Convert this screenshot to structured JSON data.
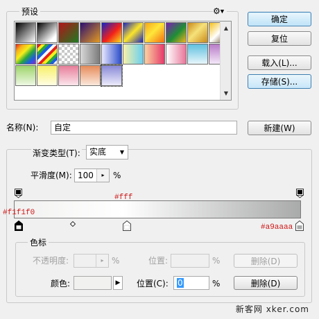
{
  "presets": {
    "title": "预设",
    "swatches": [
      [
        "linear-gradient(135deg,#000 0%,#fff 100%)"
      ],
      [
        "linear-gradient(135deg,#000 0%,#fff 80%)"
      ],
      [
        "linear-gradient(135deg,#b3141a 0%,#1f7a21 100%)"
      ],
      [
        "linear-gradient(135deg,#2a0f72 0%,#e59a20 100%)"
      ],
      [
        "linear-gradient(135deg,#1326c4 0%,#f2201a 55%,#f8e21a 100%)"
      ],
      [
        "linear-gradient(135deg,#1d26bb 0%,#fbe52a 50%,#1d26bb 100%)"
      ],
      [
        "linear-gradient(135deg,#f4a718 0%,#ffe63a 45%,#f26d12 100%)"
      ],
      [
        "linear-gradient(135deg,#7b1fb4 0%,#1e8e35 55%,#f2b21d 100%)"
      ],
      [
        "linear-gradient(135deg,#c98a1a 0%,#f6e27a 45%,#c98a1a 100%)"
      ],
      [
        "linear-gradient(135deg,#f5c01a 0%,#fff 50%,#5a3a10 100%)"
      ],
      [
        "linear-gradient(135deg,#e8211a,#f5b01a,#f7ee1a,#2aa83a,#1a5fe0,#8a2ad8)"
      ],
      [
        "repeating-linear-gradient(135deg,#e8211a 0 4px,#f7ee1a 4px 8px,#2aa83a 8px 12px,#1a5fe0 12px 16px,#fff 16px 20px)"
      ],
      [
        "repeating-conic-gradient(#c8c8c8 0 25%,#ffffff 0 50%) 0 0/8px 8px"
      ],
      [
        "linear-gradient(to right,#d8d8d8 0%,#7a7a7a 100%)"
      ],
      [
        "linear-gradient(to right,#e8e8ff 0%,#2a4cc9 100%)"
      ],
      [
        "linear-gradient(to right,#f8f0a8 0%,#6ad0f0 100%)"
      ],
      [
        "linear-gradient(to right,#fbd3a0 0%,#e6386a 100%)"
      ],
      [
        "linear-gradient(to right,#ffffff 0%,#e8769a 100%)"
      ],
      [
        "linear-gradient(to bottom,#5fc0e0 0%,#e8f6fb 100%)"
      ],
      [
        "linear-gradient(to bottom,#b87cc8 0%,#f4e8f8 100%)"
      ],
      [
        "linear-gradient(to bottom,#9ed46a 0%,#eef8e4 100%)"
      ],
      [
        "linear-gradient(to bottom,#f7f06a 0%,#fffde4 100%)"
      ],
      [
        "linear-gradient(to bottom,#e87e9a 0%,#fbe6ec 100%)"
      ],
      [
        "linear-gradient(to bottom,#e68c5a 0%,#fbe8dc 100%)"
      ],
      [
        "linear-gradient(to bottom,#8a8ad8 0%,#ecebfb 100%)"
      ]
    ]
  },
  "buttons": {
    "ok": "确定",
    "reset": "复位",
    "load": "载入(L)...",
    "save": "存储(S)...",
    "new": "新建(W)"
  },
  "name_field": {
    "label": "名称(N):",
    "value": "自定"
  },
  "gradient": {
    "type_label": "渐变类型(T):",
    "type_value": "实底",
    "smoothness_label": "平滑度(M):",
    "smoothness_value": "100",
    "smoothness_unit": "%",
    "stops": [
      {
        "color": "#f1f1f0",
        "location_pct": 0
      },
      {
        "color": "#ffffff",
        "location_pct": 38
      },
      {
        "color": "#a9aaaa",
        "location_pct": 100
      }
    ],
    "annotations": {
      "start": "#f1f1f0",
      "mid": "#fff",
      "end": "#a9aaaa"
    }
  },
  "color_stops": {
    "title": "色标",
    "opacity_label": "不透明度:",
    "opacity_unit": "%",
    "opacity_position_label": "位置:",
    "opacity_position_unit": "%",
    "opacity_delete": "删除(D)",
    "color_label": "颜色:",
    "color_position_label": "位置(C):",
    "color_position_value": "0",
    "color_position_unit": "%",
    "color_delete": "删除(D)"
  },
  "watermark": "新客网 xker.com"
}
